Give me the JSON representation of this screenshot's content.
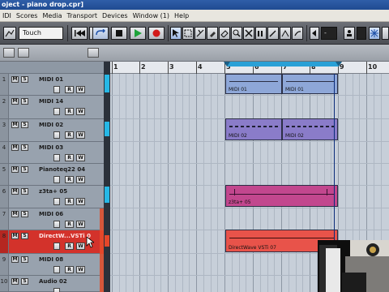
{
  "window": {
    "title": "oject - piano drop.cpr]"
  },
  "menu": [
    {
      "label": "IDI"
    },
    {
      "label": "Scores"
    },
    {
      "label": "Media"
    },
    {
      "label": "Transport"
    },
    {
      "label": "Devices"
    },
    {
      "label": "Window (1)"
    },
    {
      "label": "Help"
    }
  ],
  "toolbar": {
    "automation_mode": "Touch",
    "nudge_value": "-",
    "icons": [
      "pointer-icon",
      "range-icon",
      "split-icon",
      "glue-icon",
      "erase-icon",
      "zoom-icon",
      "mute-icon",
      "draw-icon",
      "line-icon",
      "play-icon",
      "drumstick-icon"
    ]
  },
  "ruler": {
    "bars": [
      "1",
      "2",
      "3",
      "4",
      "5",
      "6",
      "7",
      "8",
      "9",
      "10"
    ]
  },
  "tracks": [
    {
      "number": "1",
      "name": "MIDI 01",
      "mute": "M",
      "solo": "S",
      "rec": "R",
      "write": "W"
    },
    {
      "number": "2",
      "name": "MIDI 14",
      "mute": "M",
      "solo": "S",
      "rec": "R",
      "write": "W"
    },
    {
      "number": "3",
      "name": "MIDI 02",
      "mute": "M",
      "solo": "S",
      "rec": "R",
      "write": "W"
    },
    {
      "number": "4",
      "name": "MIDI 03",
      "mute": "M",
      "solo": "S",
      "rec": "R",
      "write": "W"
    },
    {
      "number": "5",
      "name": "Pianoteq22 04",
      "mute": "M",
      "solo": "S",
      "rec": "R",
      "write": "W"
    },
    {
      "number": "6",
      "name": "z3ta+ 05",
      "mute": "M",
      "solo": "S",
      "rec": "R",
      "write": "W"
    },
    {
      "number": "7",
      "name": "MIDI 06",
      "mute": "M",
      "solo": "S",
      "rec": "R",
      "write": "W"
    },
    {
      "number": "8",
      "name": "DirectW...VSTi 0",
      "mute": "M",
      "solo": "S",
      "rec": "R",
      "write": "W",
      "selected": true
    },
    {
      "number": "9",
      "name": "MIDI 08",
      "mute": "M",
      "solo": "S",
      "rec": "R",
      "write": "W"
    },
    {
      "number": "10",
      "name": "Audio 02",
      "mute": "M",
      "solo": "S",
      "rec": "R",
      "write": "W"
    }
  ],
  "parts": [
    {
      "label": "MIDI 01",
      "color": "#8ea7d8"
    },
    {
      "label": "MIDI 01",
      "color": "#8ea7d8"
    },
    {
      "label": "MIDI 02",
      "color": "#8a7cc9"
    },
    {
      "label": "MIDI 02",
      "color": "#8a7cc9"
    },
    {
      "label": "z3ta+ 05",
      "color": "#c2478e"
    },
    {
      "label": "DirectWave VSTi 07",
      "color": "#e8534a"
    }
  ],
  "colors": {
    "accent": "#26b8e6",
    "selected_track": "#d3322b"
  }
}
